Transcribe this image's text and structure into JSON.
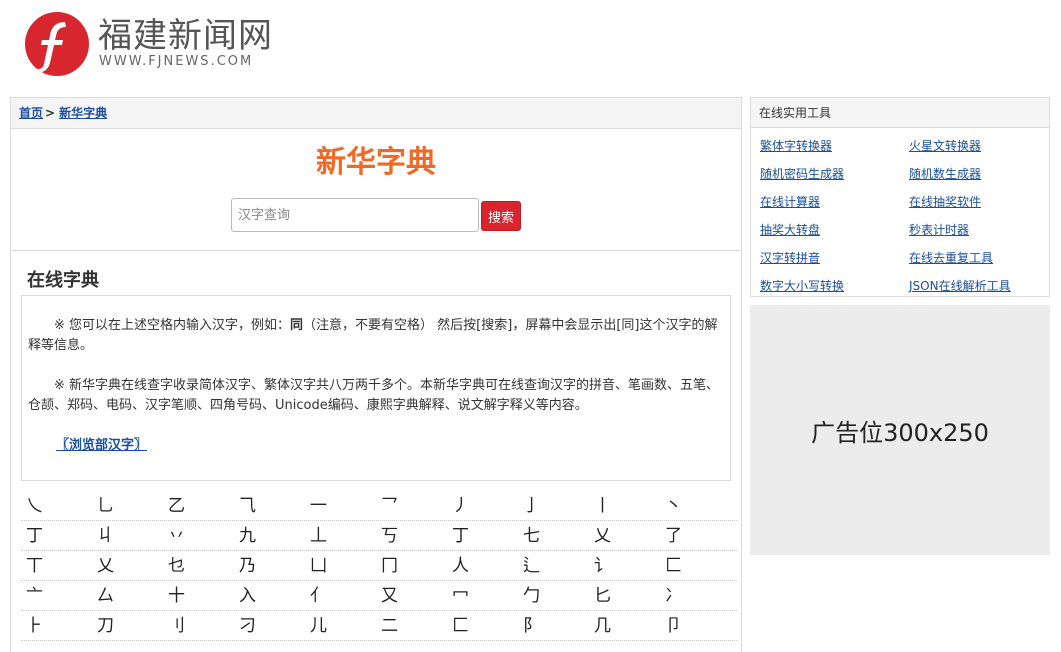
{
  "header": {
    "site_name": "福建新闻网",
    "site_url": "WWW.FJNEWS.COM",
    "logo_icon": "fjnews-logo-icon"
  },
  "breadcrumb": {
    "home": "首页",
    "separator": ">",
    "current": "新华字典"
  },
  "search": {
    "title": "新华字典",
    "placeholder": "汉字查询",
    "button_label": "搜索"
  },
  "section": {
    "title": "在线字典",
    "para1_prefix": "※ 您可以在上述空格内输入汉字，例如：",
    "para1_example": "同",
    "para1_suffix": "（注意，不要有空格） 然后按[搜索]，屏幕中会显示出[同]这个汉字的解释等信息。",
    "para2": "※ 新华字典在线查字收录简体汉字、繁体汉字共八万两千多个。本新华字典可在线查询汉字的拼音、笔画数、五笔、仓颉、郑码、电码、汉字笔顺、四角号码、Unicode编码、康熙字典解释、说文解字释义等内容。",
    "browse_link": "〖浏览部汉字〗"
  },
  "radicals": [
    [
      "乀",
      "乚",
      "乙",
      "⺄",
      "一",
      "乛",
      "丿",
      "亅",
      "丨",
      "丶"
    ],
    [
      "丁",
      "丩",
      "丷",
      "九",
      "丄",
      "丂",
      "丁",
      "七",
      "乂",
      "了"
    ],
    [
      "丅",
      "乂",
      "乜",
      "乃",
      "凵",
      "冂",
      "人",
      "⻍",
      "讠",
      "匚"
    ],
    [
      "亠",
      "厶",
      "十",
      "入",
      "亻",
      "又",
      "冖",
      "勹",
      "匕",
      "冫"
    ],
    [
      "⺊",
      "刀",
      "刂",
      "刁",
      "儿",
      "二",
      "匚",
      "阝",
      "几",
      "卩"
    ]
  ],
  "sidebar": {
    "title": "在线实用工具",
    "tools": [
      "繁体字转换器",
      "火星文转换器",
      "随机密码生成器",
      "随机数生成器",
      "在线计算器",
      "在线抽奖软件",
      "抽奖大转盘",
      "秒表计时器",
      "汉字转拼音",
      "在线去重复工具",
      "数字大小写转换",
      "JSON在线解析工具"
    ]
  },
  "ad": {
    "label": "广告位300x250"
  }
}
